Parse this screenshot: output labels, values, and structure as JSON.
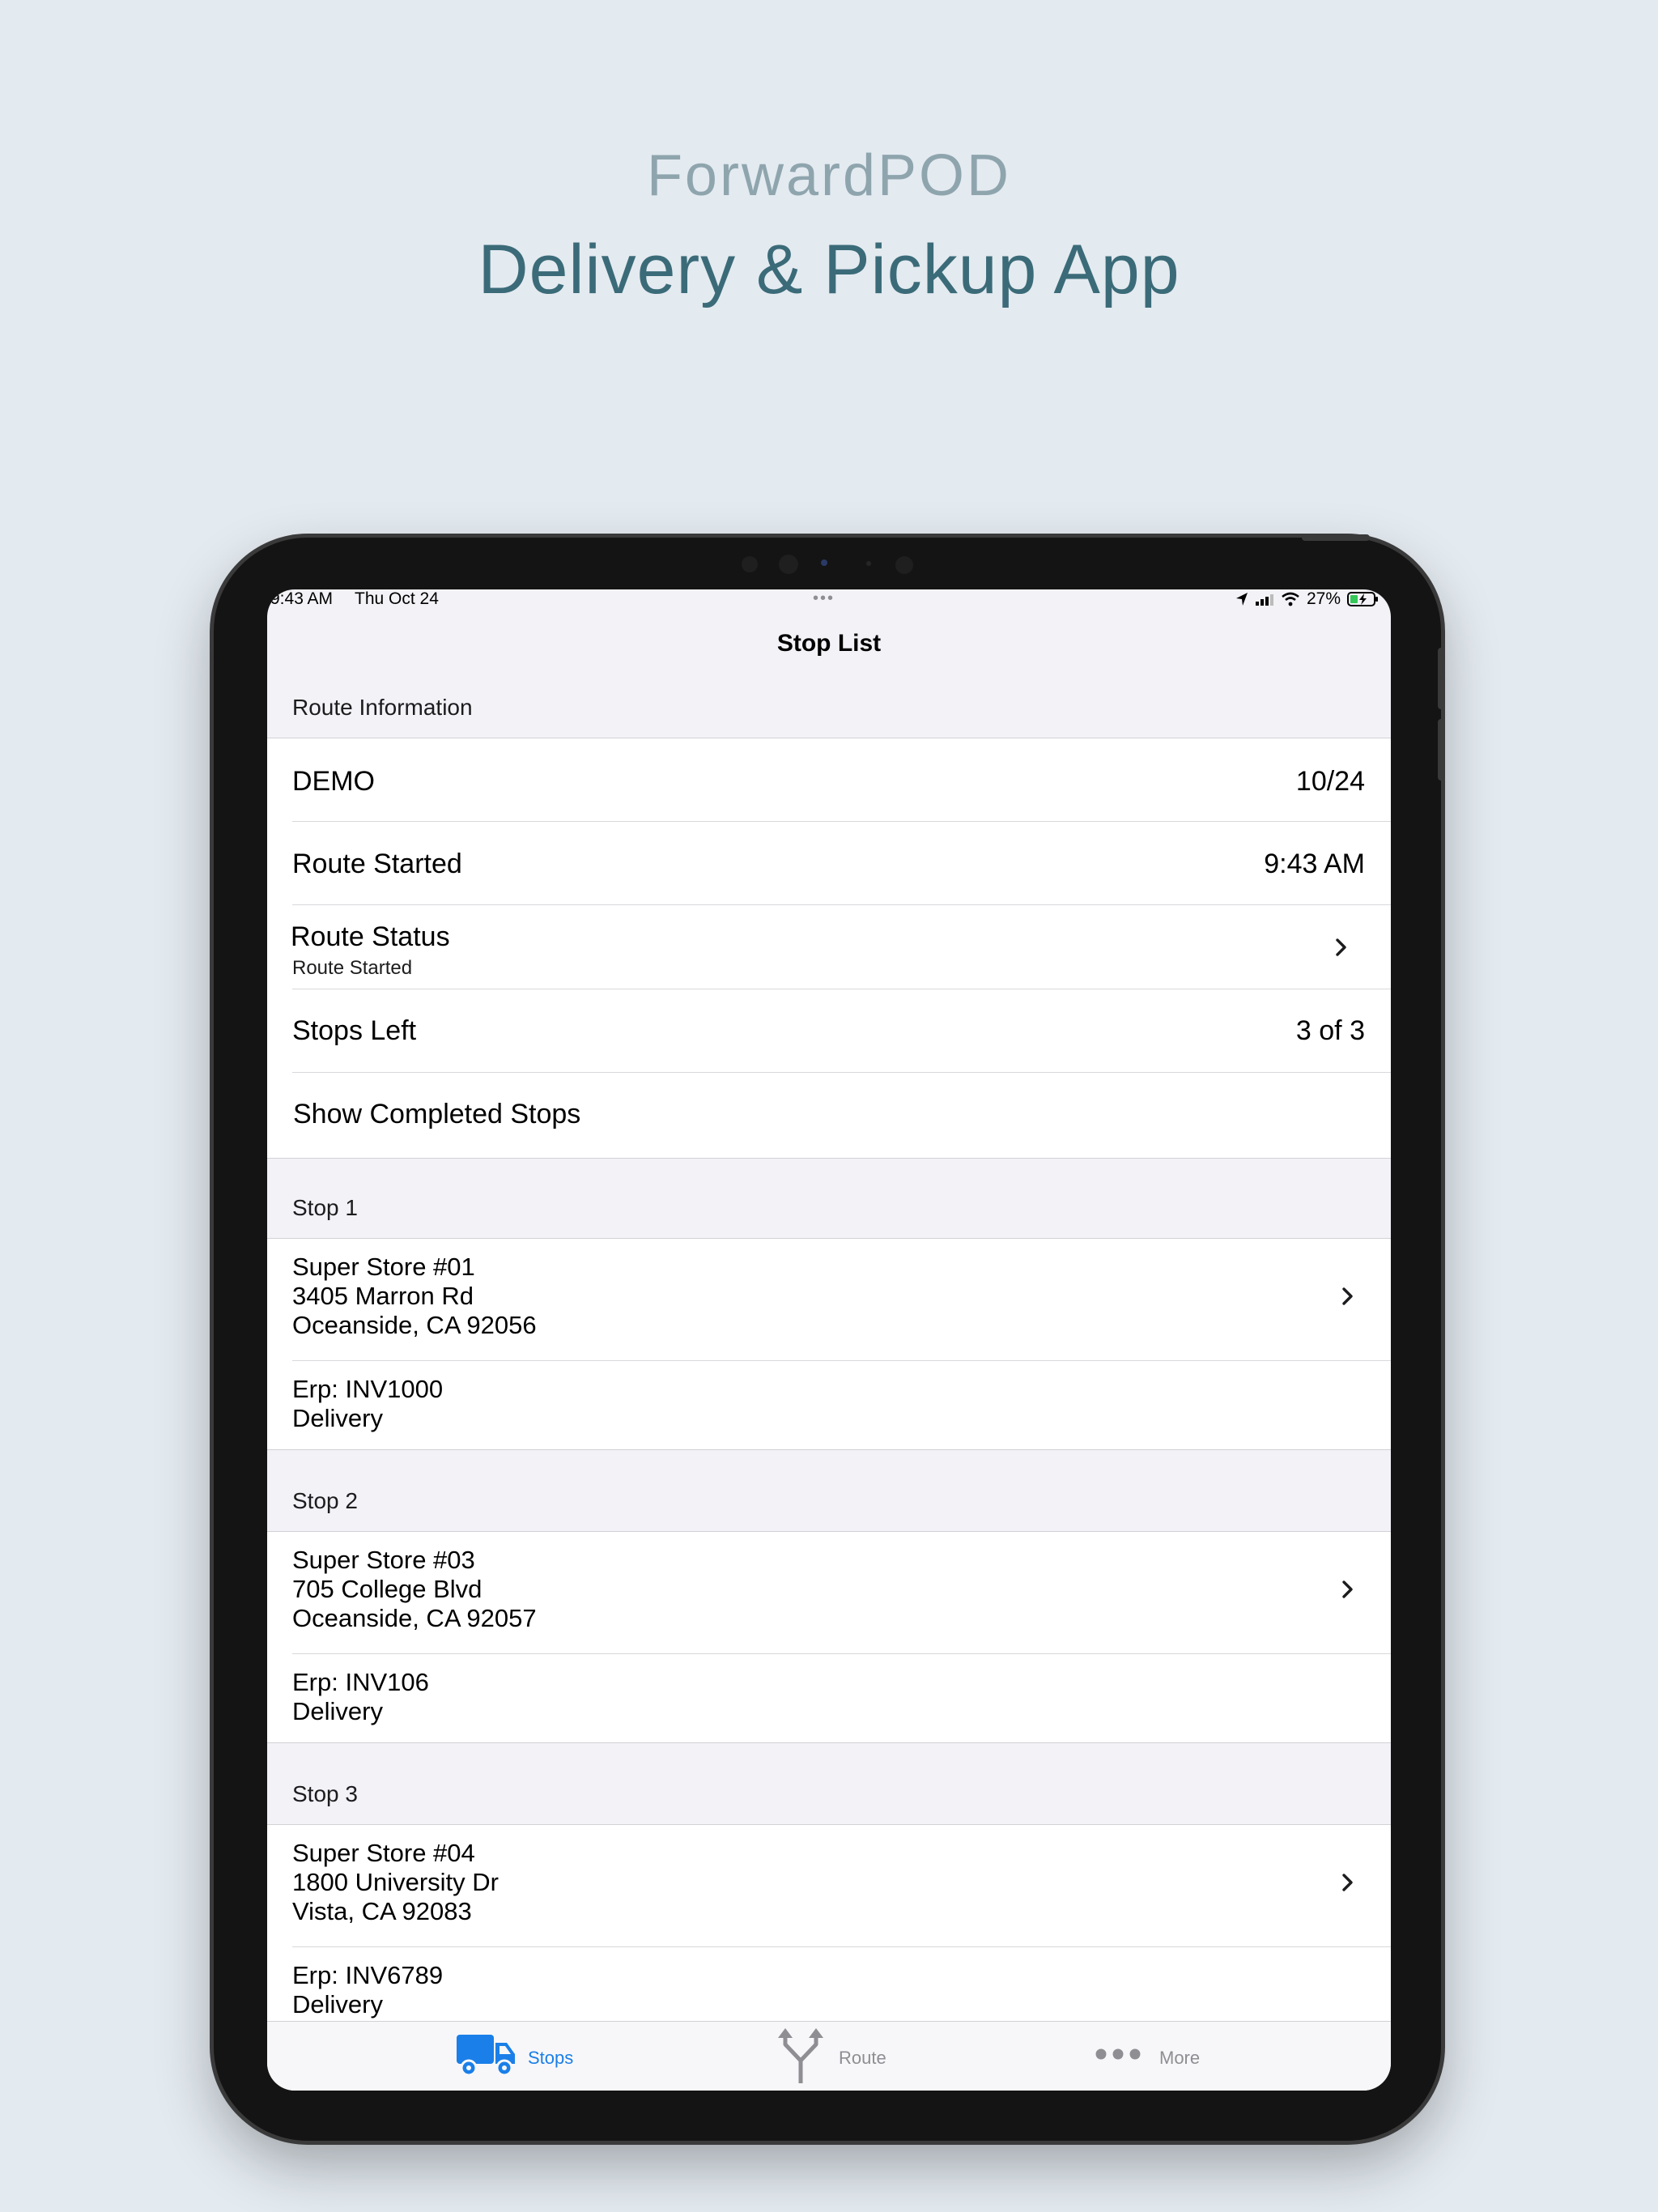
{
  "promo": {
    "brand": "ForwardPOD",
    "tagline": "Delivery & Pickup App"
  },
  "status_bar": {
    "time": "9:43 AM",
    "date": "Thu Oct 24",
    "battery": "27%"
  },
  "nav": {
    "title": "Stop List"
  },
  "route_info": {
    "header": "Route Information",
    "route_name": "DEMO",
    "route_date": "10/24",
    "started_label": "Route Started",
    "started_value": "9:43 AM",
    "status_label": "Route Status",
    "status_value": "Route Started",
    "stops_left_label": "Stops Left",
    "stops_left_value": "3 of 3",
    "show_completed_label": "Show Completed Stops"
  },
  "stops": [
    {
      "header": "Stop 1",
      "name": "Super Store #01",
      "street": "3405 Marron Rd",
      "city": "Oceanside, CA 92056",
      "erp": "Erp: INV1000",
      "type": "Delivery"
    },
    {
      "header": "Stop 2",
      "name": "Super Store #03",
      "street": "705 College Blvd",
      "city": "Oceanside, CA 92057",
      "erp": "Erp: INV106",
      "type": "Delivery"
    },
    {
      "header": "Stop 3",
      "name": "Super Store #04",
      "street": "1800 University Dr",
      "city": "Vista, CA 92083",
      "erp": "Erp: INV6789",
      "type": "Delivery"
    }
  ],
  "tabs": {
    "stops": "Stops",
    "route": "Route",
    "more": "More"
  },
  "colors": {
    "accent": "#1a7fe8",
    "inactive": "#8e8e93",
    "background": "#f2f2f7"
  }
}
